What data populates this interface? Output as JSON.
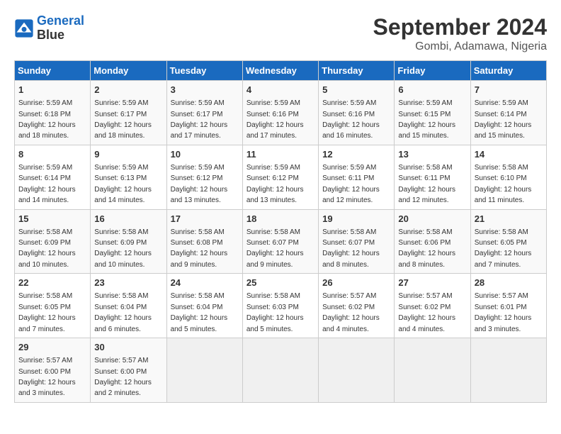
{
  "logo": {
    "line1": "General",
    "line2": "Blue"
  },
  "title": "September 2024",
  "location": "Gombi, Adamawa, Nigeria",
  "days_of_week": [
    "Sunday",
    "Monday",
    "Tuesday",
    "Wednesday",
    "Thursday",
    "Friday",
    "Saturday"
  ],
  "weeks": [
    [
      {
        "day": "1",
        "sunrise": "5:59 AM",
        "sunset": "6:18 PM",
        "daylight": "12 hours and 18 minutes."
      },
      {
        "day": "2",
        "sunrise": "5:59 AM",
        "sunset": "6:17 PM",
        "daylight": "12 hours and 18 minutes."
      },
      {
        "day": "3",
        "sunrise": "5:59 AM",
        "sunset": "6:17 PM",
        "daylight": "12 hours and 17 minutes."
      },
      {
        "day": "4",
        "sunrise": "5:59 AM",
        "sunset": "6:16 PM",
        "daylight": "12 hours and 17 minutes."
      },
      {
        "day": "5",
        "sunrise": "5:59 AM",
        "sunset": "6:16 PM",
        "daylight": "12 hours and 16 minutes."
      },
      {
        "day": "6",
        "sunrise": "5:59 AM",
        "sunset": "6:15 PM",
        "daylight": "12 hours and 15 minutes."
      },
      {
        "day": "7",
        "sunrise": "5:59 AM",
        "sunset": "6:14 PM",
        "daylight": "12 hours and 15 minutes."
      }
    ],
    [
      {
        "day": "8",
        "sunrise": "5:59 AM",
        "sunset": "6:14 PM",
        "daylight": "12 hours and 14 minutes."
      },
      {
        "day": "9",
        "sunrise": "5:59 AM",
        "sunset": "6:13 PM",
        "daylight": "12 hours and 14 minutes."
      },
      {
        "day": "10",
        "sunrise": "5:59 AM",
        "sunset": "6:12 PM",
        "daylight": "12 hours and 13 minutes."
      },
      {
        "day": "11",
        "sunrise": "5:59 AM",
        "sunset": "6:12 PM",
        "daylight": "12 hours and 13 minutes."
      },
      {
        "day": "12",
        "sunrise": "5:59 AM",
        "sunset": "6:11 PM",
        "daylight": "12 hours and 12 minutes."
      },
      {
        "day": "13",
        "sunrise": "5:58 AM",
        "sunset": "6:11 PM",
        "daylight": "12 hours and 12 minutes."
      },
      {
        "day": "14",
        "sunrise": "5:58 AM",
        "sunset": "6:10 PM",
        "daylight": "12 hours and 11 minutes."
      }
    ],
    [
      {
        "day": "15",
        "sunrise": "5:58 AM",
        "sunset": "6:09 PM",
        "daylight": "12 hours and 10 minutes."
      },
      {
        "day": "16",
        "sunrise": "5:58 AM",
        "sunset": "6:09 PM",
        "daylight": "12 hours and 10 minutes."
      },
      {
        "day": "17",
        "sunrise": "5:58 AM",
        "sunset": "6:08 PM",
        "daylight": "12 hours and 9 minutes."
      },
      {
        "day": "18",
        "sunrise": "5:58 AM",
        "sunset": "6:07 PM",
        "daylight": "12 hours and 9 minutes."
      },
      {
        "day": "19",
        "sunrise": "5:58 AM",
        "sunset": "6:07 PM",
        "daylight": "12 hours and 8 minutes."
      },
      {
        "day": "20",
        "sunrise": "5:58 AM",
        "sunset": "6:06 PM",
        "daylight": "12 hours and 8 minutes."
      },
      {
        "day": "21",
        "sunrise": "5:58 AM",
        "sunset": "6:05 PM",
        "daylight": "12 hours and 7 minutes."
      }
    ],
    [
      {
        "day": "22",
        "sunrise": "5:58 AM",
        "sunset": "6:05 PM",
        "daylight": "12 hours and 7 minutes."
      },
      {
        "day": "23",
        "sunrise": "5:58 AM",
        "sunset": "6:04 PM",
        "daylight": "12 hours and 6 minutes."
      },
      {
        "day": "24",
        "sunrise": "5:58 AM",
        "sunset": "6:04 PM",
        "daylight": "12 hours and 5 minutes."
      },
      {
        "day": "25",
        "sunrise": "5:58 AM",
        "sunset": "6:03 PM",
        "daylight": "12 hours and 5 minutes."
      },
      {
        "day": "26",
        "sunrise": "5:57 AM",
        "sunset": "6:02 PM",
        "daylight": "12 hours and 4 minutes."
      },
      {
        "day": "27",
        "sunrise": "5:57 AM",
        "sunset": "6:02 PM",
        "daylight": "12 hours and 4 minutes."
      },
      {
        "day": "28",
        "sunrise": "5:57 AM",
        "sunset": "6:01 PM",
        "daylight": "12 hours and 3 minutes."
      }
    ],
    [
      {
        "day": "29",
        "sunrise": "5:57 AM",
        "sunset": "6:00 PM",
        "daylight": "12 hours and 3 minutes."
      },
      {
        "day": "30",
        "sunrise": "5:57 AM",
        "sunset": "6:00 PM",
        "daylight": "12 hours and 2 minutes."
      },
      null,
      null,
      null,
      null,
      null
    ]
  ]
}
